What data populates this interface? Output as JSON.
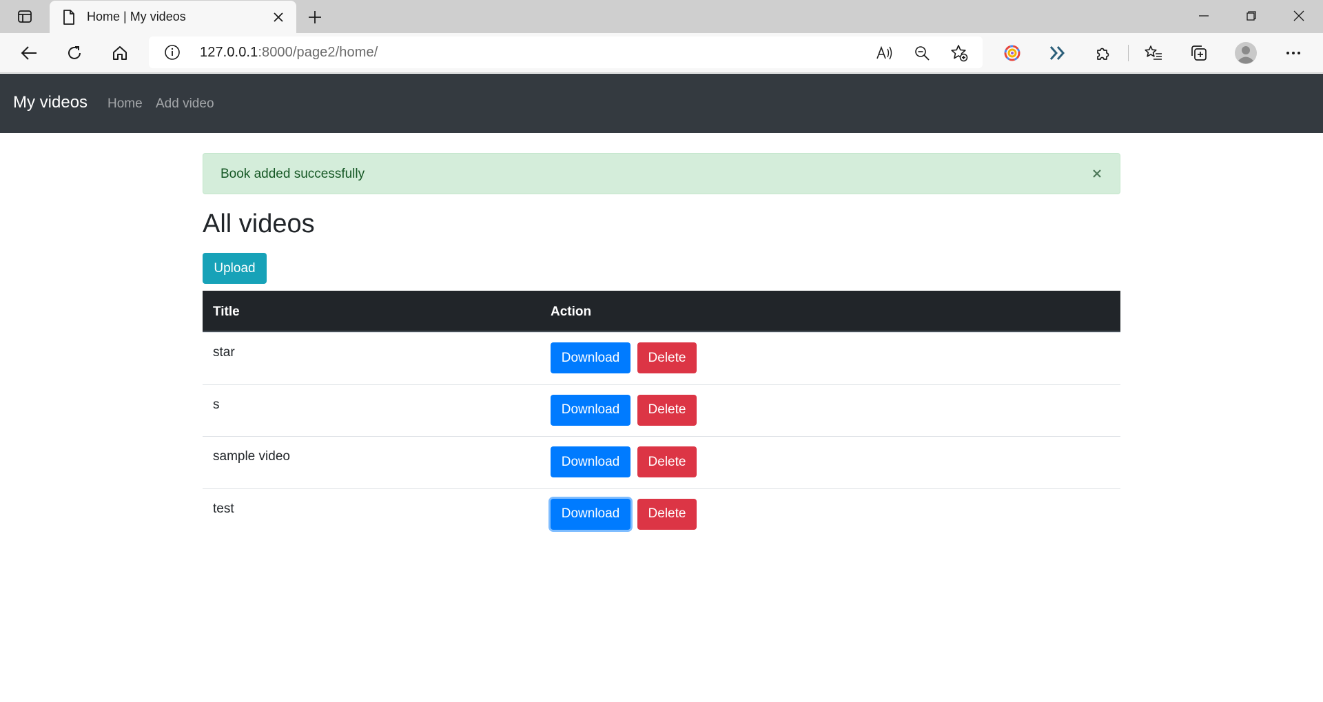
{
  "browser": {
    "tab_title": "Home | My videos",
    "url_host": "127.0.0.1",
    "url_rest": ":8000/page2/home/"
  },
  "navbar": {
    "brand": "My videos",
    "links": [
      "Home",
      "Add video"
    ]
  },
  "alert": {
    "message": "Book added successfully",
    "close_symbol": "×"
  },
  "page": {
    "heading": "All videos",
    "upload_label": "Upload"
  },
  "table": {
    "headers": [
      "Title",
      "Action"
    ],
    "rows": [
      {
        "title": "star",
        "download": "Download",
        "delete": "Delete"
      },
      {
        "title": "s",
        "download": "Download",
        "delete": "Delete"
      },
      {
        "title": "sample video",
        "download": "Download",
        "delete": "Delete"
      },
      {
        "title": "test",
        "download": "Download",
        "delete": "Delete"
      }
    ]
  },
  "colors": {
    "navbar_bg": "#343a40",
    "alert_bg": "#d4edda",
    "upload_btn": "#17a2b8",
    "download_btn": "#007bff",
    "delete_btn": "#dc3545",
    "table_header_bg": "#212529"
  },
  "icons": [
    "sidebar-toggle-icon",
    "page-icon",
    "close-icon",
    "plus-icon",
    "minimize-icon",
    "restore-icon",
    "window-close-icon",
    "back-icon",
    "refresh-icon",
    "home-icon",
    "info-icon",
    "read-aloud-icon",
    "zoom-out-icon",
    "add-favorite-icon",
    "extension-color-icon",
    "chevrons-icon",
    "puzzle-icon",
    "favorites-icon",
    "collections-icon",
    "profile-icon",
    "more-icon"
  ]
}
